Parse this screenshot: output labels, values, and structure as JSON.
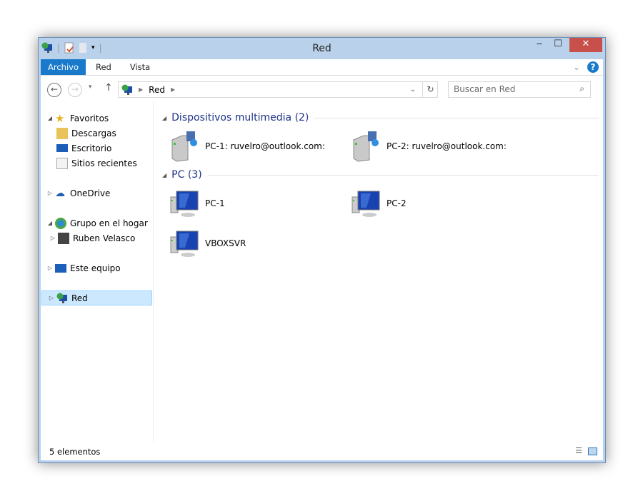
{
  "window": {
    "title": "Red",
    "minimize": "‒",
    "maximize": "☐",
    "close": "✕"
  },
  "ribbon": {
    "tabs": [
      "Archivo",
      "Red",
      "Vista"
    ]
  },
  "address": {
    "location": "Red",
    "search_placeholder": "Buscar en Red"
  },
  "nav": {
    "favorites": "Favoritos",
    "descargas": "Descargas",
    "escritorio": "Escritorio",
    "recientes": "Sitios recientes",
    "onedrive": "OneDrive",
    "homegroup": "Grupo en el hogar",
    "user": "Ruben Velasco",
    "thispc": "Este equipo",
    "network": "Red"
  },
  "groups": [
    {
      "title": "Dispositivos multimedia (2)",
      "items": [
        "PC-1: ruvelro@outlook.com:",
        "PC-2: ruvelro@outlook.com:"
      ]
    },
    {
      "title": "PC (3)",
      "items": [
        "PC-1",
        "PC-2",
        "VBOXSVR"
      ]
    }
  ],
  "status": {
    "count": "5 elementos"
  }
}
